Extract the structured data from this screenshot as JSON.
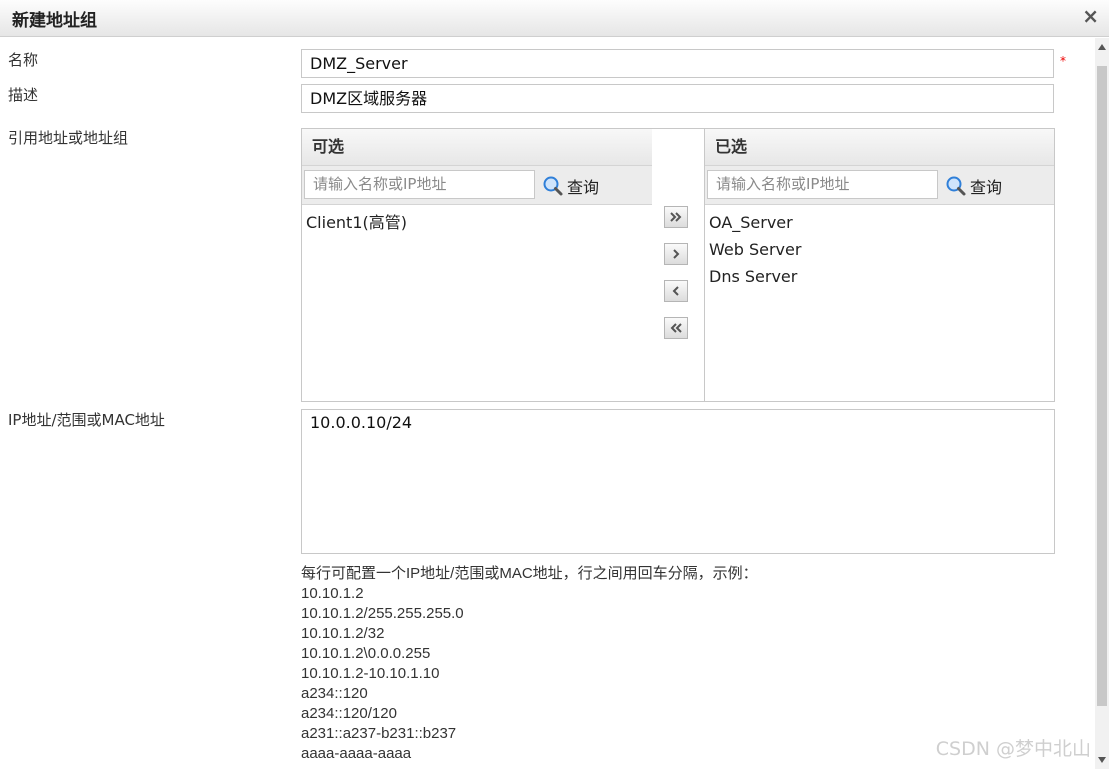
{
  "dialog": {
    "title": "新建地址组",
    "close_symbol": "×"
  },
  "form": {
    "name_label": "名称",
    "name_value": "DMZ_Server",
    "required_mark": "*",
    "desc_label": "描述",
    "desc_value": "DMZ区域服务器",
    "ref_label": "引用地址或地址组",
    "ip_label": "IP地址/范围或MAC地址",
    "ip_value": "10.0.0.10/24"
  },
  "available": {
    "header": "可选",
    "search_placeholder": "请输入名称或IP地址",
    "search_button": "查询",
    "items": [
      "Client1(高管)"
    ]
  },
  "selected": {
    "header": "已选",
    "search_placeholder": "请输入名称或IP地址",
    "search_button": "查询",
    "items": [
      "OA_Server",
      "Web Server",
      "Dns Server"
    ]
  },
  "transfer_buttons": [
    "add-all",
    "add",
    "remove",
    "remove-all"
  ],
  "hint": {
    "intro": "每行可配置一个IP地址/范围或MAC地址，行之间用回车分隔，示例：",
    "examples": [
      "10.10.1.2",
      "10.10.1.2/255.255.255.0",
      "10.10.1.2/32",
      "10.10.1.2\\0.0.0.255",
      "10.10.1.2-10.10.1.10",
      "a234::120",
      "a234::120/120",
      "a231::a237-b231::b237",
      "aaaa-aaaa-aaaa"
    ]
  },
  "watermark": "CSDN @梦中北山"
}
